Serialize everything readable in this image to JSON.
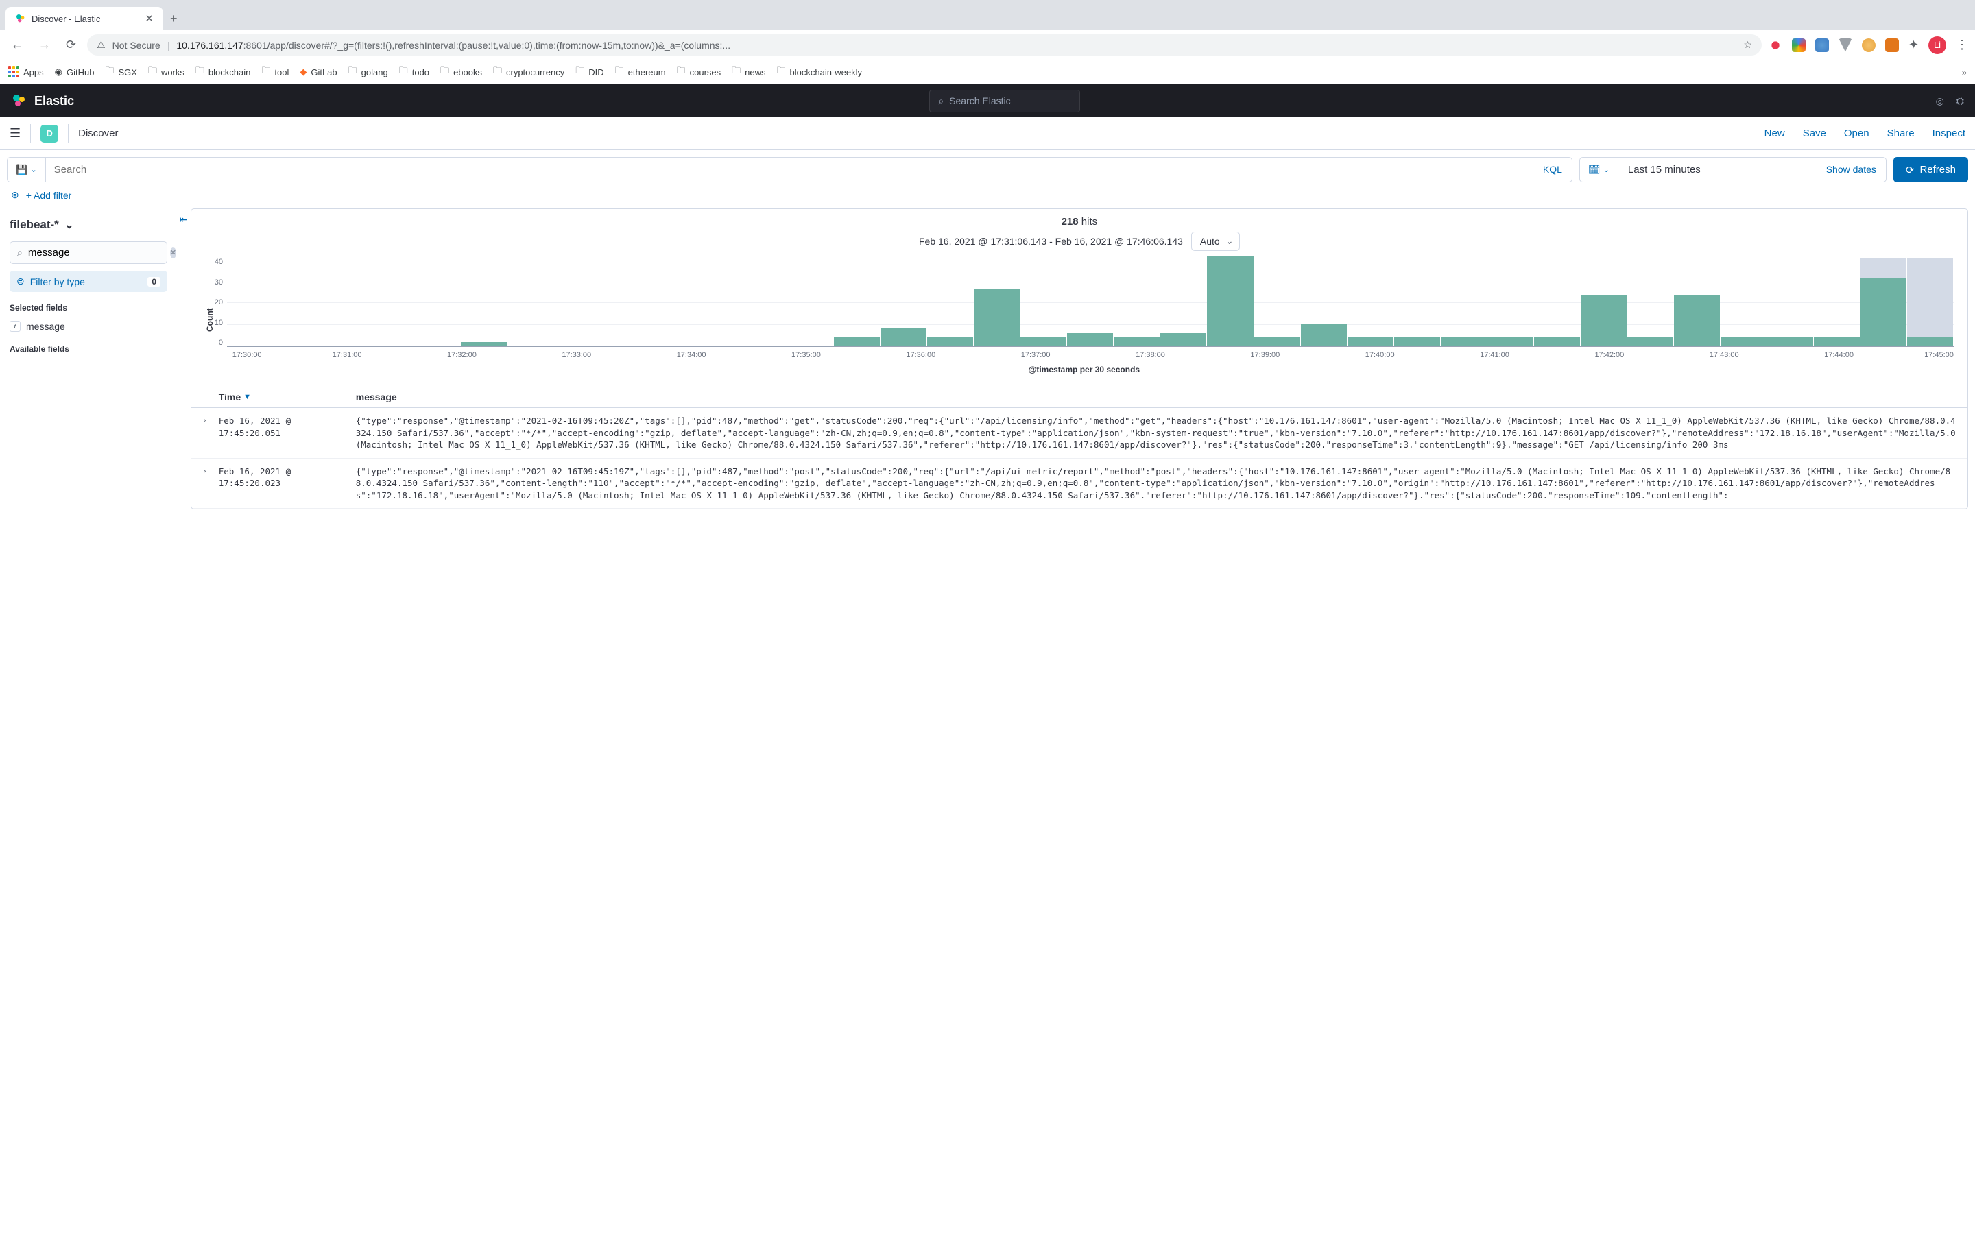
{
  "browser": {
    "tab_title": "Discover - Elastic",
    "url_insecure": "Not Secure",
    "url_host": "10.176.161.147",
    "url_path": ":8601/app/discover#/?_g=(filters:!(),refreshInterval:(pause:!t,value:0),time:(from:now-15m,to:now))&_a=(columns:...",
    "bookmarks": [
      "Apps",
      "GitHub",
      "SGX",
      "works",
      "blockchain",
      "tool",
      "GitLab",
      "golang",
      "todo",
      "ebooks",
      "cryptocurrency",
      "DID",
      "ethereum",
      "courses",
      "news",
      "blockchain-weekly"
    ],
    "avatar": "Li"
  },
  "header": {
    "brand": "Elastic",
    "search_placeholder": "Search Elastic"
  },
  "kbn": {
    "badge": "D",
    "title": "Discover",
    "actions": [
      "New",
      "Save",
      "Open",
      "Share",
      "Inspect"
    ]
  },
  "query": {
    "search_placeholder": "Search",
    "kql": "KQL",
    "time_range": "Last 15 minutes",
    "show_dates": "Show dates",
    "refresh": "Refresh",
    "add_filter": "+ Add filter"
  },
  "sidebar": {
    "index_pattern": "filebeat-*",
    "field_filter_value": "message",
    "filter_by_type": "Filter by type",
    "filter_count": "0",
    "selected_heading": "Selected fields",
    "selected_fields": [
      {
        "badge": "t",
        "name": "message"
      }
    ],
    "available_heading": "Available fields"
  },
  "hits": {
    "count": "218",
    "label": "hits"
  },
  "daterow": {
    "range": "Feb 16, 2021 @ 17:31:06.143 - Feb 16, 2021 @ 17:46:06.143",
    "interval": "Auto"
  },
  "chart_data": {
    "type": "bar",
    "ylabel": "Count",
    "xlabel": "@timestamp per 30 seconds",
    "ylim": [
      0,
      40
    ],
    "y_ticks": [
      "40",
      "30",
      "20",
      "10",
      "0"
    ],
    "x_ticks": [
      "17:30:00",
      "17:31:00",
      "17:32:00",
      "17:33:00",
      "17:34:00",
      "17:35:00",
      "17:36:00",
      "17:37:00",
      "17:38:00",
      "17:39:00",
      "17:40:00",
      "17:41:00",
      "17:42:00",
      "17:43:00",
      "17:44:00",
      "17:45:00"
    ],
    "values": [
      0,
      0,
      0,
      0,
      0,
      2,
      0,
      0,
      0,
      0,
      0,
      0,
      0,
      4,
      8,
      4,
      26,
      4,
      6,
      4,
      6,
      41,
      4,
      10,
      4,
      4,
      4,
      4,
      4,
      23,
      4,
      23,
      4,
      4,
      4,
      31,
      4
    ],
    "shaded_from_index": 35
  },
  "table": {
    "col_time": "Time",
    "col_msg": "message",
    "rows": [
      {
        "time": "Feb 16, 2021 @ 17:45:20.051",
        "msg": "{\"type\":\"response\",\"@timestamp\":\"2021-02-16T09:45:20Z\",\"tags\":[],\"pid\":487,\"method\":\"get\",\"statusCode\":200,\"req\":{\"url\":\"/api/licensing/info\",\"method\":\"get\",\"headers\":{\"host\":\"10.176.161.147:8601\",\"user-agent\":\"Mozilla/5.0 (Macintosh; Intel Mac OS X 11_1_0) AppleWebKit/537.36 (KHTML, like Gecko) Chrome/88.0.4324.150 Safari/537.36\",\"accept\":\"*/*\",\"accept-encoding\":\"gzip, deflate\",\"accept-language\":\"zh-CN,zh;q=0.9,en;q=0.8\",\"content-type\":\"application/json\",\"kbn-system-request\":\"true\",\"kbn-version\":\"7.10.0\",\"referer\":\"http://10.176.161.147:8601/app/discover?\"},\"remoteAddress\":\"172.18.16.18\",\"userAgent\":\"Mozilla/5.0 (Macintosh; Intel Mac OS X 11_1_0) AppleWebKit/537.36 (KHTML, like Gecko) Chrome/88.0.4324.150 Safari/537.36\",\"referer\":\"http://10.176.161.147:8601/app/discover?\"}.\"res\":{\"statusCode\":200.\"responseTime\":3.\"contentLength\":9}.\"message\":\"GET /api/licensing/info 200 3ms"
      },
      {
        "time": "Feb 16, 2021 @ 17:45:20.023",
        "msg": "{\"type\":\"response\",\"@timestamp\":\"2021-02-16T09:45:19Z\",\"tags\":[],\"pid\":487,\"method\":\"post\",\"statusCode\":200,\"req\":{\"url\":\"/api/ui_metric/report\",\"method\":\"post\",\"headers\":{\"host\":\"10.176.161.147:8601\",\"user-agent\":\"Mozilla/5.0 (Macintosh; Intel Mac OS X 11_1_0) AppleWebKit/537.36 (KHTML, like Gecko) Chrome/88.0.4324.150 Safari/537.36\",\"content-length\":\"110\",\"accept\":\"*/*\",\"accept-encoding\":\"gzip, deflate\",\"accept-language\":\"zh-CN,zh;q=0.9,en;q=0.8\",\"content-type\":\"application/json\",\"kbn-version\":\"7.10.0\",\"origin\":\"http://10.176.161.147:8601\",\"referer\":\"http://10.176.161.147:8601/app/discover?\"},\"remoteAddress\":\"172.18.16.18\",\"userAgent\":\"Mozilla/5.0 (Macintosh; Intel Mac OS X 11_1_0) AppleWebKit/537.36 (KHTML, like Gecko) Chrome/88.0.4324.150 Safari/537.36\".\"referer\":\"http://10.176.161.147:8601/app/discover?\"}.\"res\":{\"statusCode\":200.\"responseTime\":109.\"contentLength\":"
      }
    ]
  }
}
